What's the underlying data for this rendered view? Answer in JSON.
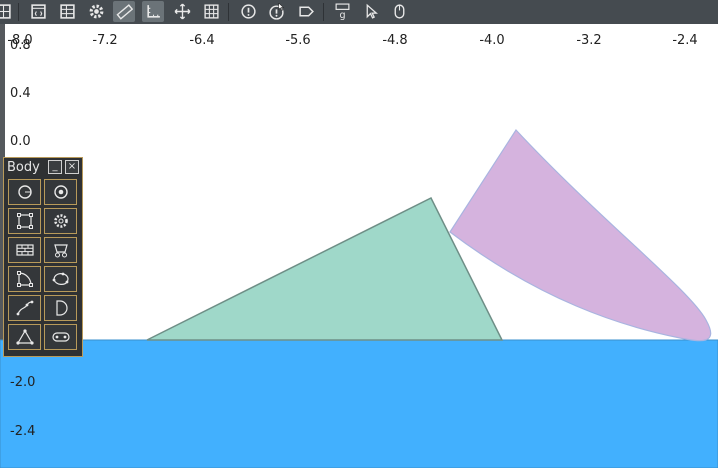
{
  "toolbar": {
    "tools": [
      {
        "icon": "grid-window-icon",
        "active": false
      },
      {
        "icon": "code-window-icon",
        "active": false
      },
      {
        "icon": "table-icon",
        "active": false
      },
      {
        "icon": "gear-icon",
        "active": false
      },
      {
        "icon": "ruler-icon",
        "active": true
      },
      {
        "icon": "axes-icon",
        "active": true
      },
      {
        "icon": "move-icon",
        "active": false
      },
      {
        "icon": "grid-icon",
        "active": false
      },
      {
        "icon": "alert-icon",
        "active": false
      },
      {
        "icon": "alert-cursor-icon",
        "active": false
      },
      {
        "icon": "tag-icon",
        "active": false
      },
      {
        "icon": "gravity-icon",
        "active": false
      },
      {
        "icon": "pointer-icon",
        "active": false
      },
      {
        "icon": "mouse-icon",
        "active": false
      }
    ]
  },
  "x_axis": {
    "ticks": [
      "-8.0",
      "-7.2",
      "-6.4",
      "-5.6",
      "-4.8",
      "-4.0",
      "-3.2",
      "-2.4"
    ]
  },
  "y_axis": {
    "ticks": [
      "0.8",
      "0.4",
      "0.0",
      "-2.0",
      "-2.4"
    ]
  },
  "panel": {
    "title": "Body",
    "minimize_label": "_",
    "close_label": "×",
    "tools": [
      "circle-icon",
      "disc-icon",
      "rectangle-icon",
      "cog-icon",
      "brick-wall-icon",
      "cart-icon",
      "quarter-circle-icon",
      "blob-icon",
      "curve-icon",
      "half-disc-icon",
      "triangle-nodes-icon",
      "capsule-icon"
    ]
  },
  "colors": {
    "toolbar": "#454b50",
    "ground": "#42b0fe",
    "triangle_fill": "#9fd8c9",
    "triangle_stroke": "#6f8f87",
    "petal_fill": "#d5b3de",
    "petal_stroke": "#a9b4e0",
    "panel_border": "#b89a5a"
  }
}
